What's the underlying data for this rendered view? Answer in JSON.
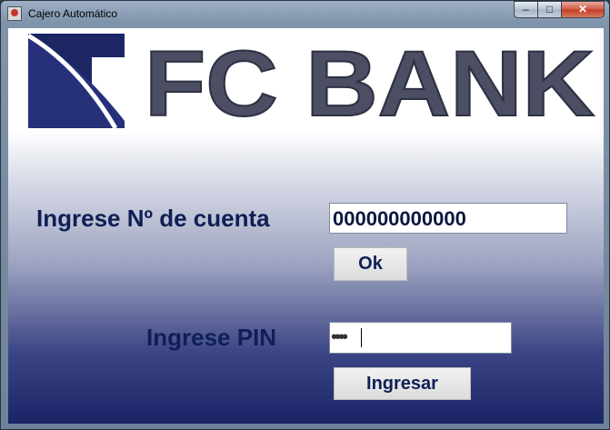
{
  "window": {
    "title": "Cajero Automático"
  },
  "controls": {
    "minimize": "–",
    "maximize": "□",
    "close": "✕"
  },
  "brand": {
    "logo_text": "FC BANK"
  },
  "account": {
    "label": "Ingrese Nº de cuenta",
    "value": "000000000000",
    "button": "Ok"
  },
  "pin": {
    "label": "Ingrese PIN",
    "masked_value": "••••",
    "button": "Ingresar"
  },
  "colors": {
    "label_text": "#0f1f55",
    "logo_fill": "#4c4f63",
    "logo_mark": "#1b2663"
  },
  "icons": [
    "app-icon",
    "minimize-icon",
    "maximize-icon",
    "close-icon"
  ]
}
